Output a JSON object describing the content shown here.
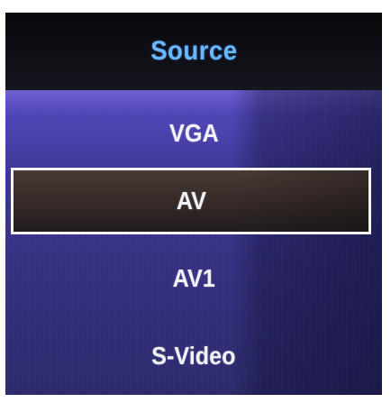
{
  "menu": {
    "title": "Source",
    "selected_index": 1,
    "items": [
      {
        "label": "VGA"
      },
      {
        "label": "AV"
      },
      {
        "label": "AV1"
      },
      {
        "label": "S-Video"
      }
    ]
  },
  "colors": {
    "title": "#69b7ff",
    "item_text": "#f2f2f6",
    "selection_border": "#f4f4f4",
    "menu_background_top": "#6c5fd2",
    "menu_background_bottom": "#2c2a6c",
    "selected_background": "#3a2e2b",
    "header_background": "#0a0a12"
  }
}
